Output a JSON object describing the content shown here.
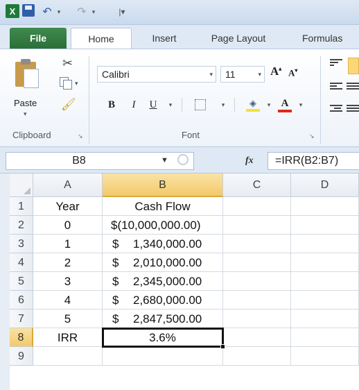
{
  "title_bar": {
    "app_icon": "excel-logo",
    "app_letter": "X",
    "quick_access": [
      "save-icon",
      "undo-icon",
      "redo-icon",
      "customize-icon"
    ]
  },
  "tabs": {
    "file": "File",
    "home": "Home",
    "insert": "Insert",
    "page_layout": "Page Layout",
    "formulas": "Formulas"
  },
  "ribbon": {
    "clipboard": {
      "paste_label": "Paste",
      "group_label": "Clipboard"
    },
    "font": {
      "font_name": "Calibri",
      "font_size": "11",
      "bold": "B",
      "italic": "I",
      "underline": "U",
      "grow_font": "A",
      "shrink_font": "A",
      "font_color_glyph": "A",
      "group_label": "Font",
      "fill_color": "#f2e23a",
      "font_color": "#e0261b"
    }
  },
  "formula_bar": {
    "name_box": "B8",
    "fx_label": "fx",
    "formula": "=IRR(B2:B7)"
  },
  "sheet": {
    "columns": [
      "A",
      "B",
      "C",
      "D"
    ],
    "selected_column": "B",
    "rows": [
      "1",
      "2",
      "3",
      "4",
      "5",
      "6",
      "7",
      "8",
      "9"
    ],
    "selected_row": "8",
    "header_row": {
      "a": "Year",
      "b": "Cash Flow"
    },
    "data": [
      {
        "year": "0",
        "currency": "$",
        "amount": "(10,000,000.00)"
      },
      {
        "year": "1",
        "currency": "$",
        "amount": "1,340,000.00"
      },
      {
        "year": "2",
        "currency": "$",
        "amount": "2,010,000.00"
      },
      {
        "year": "3",
        "currency": "$",
        "amount": "2,345,000.00"
      },
      {
        "year": "4",
        "currency": "$",
        "amount": "2,680,000.00"
      },
      {
        "year": "5",
        "currency": "$",
        "amount": "2,847,500.00"
      }
    ],
    "irr_label": "IRR",
    "irr_value": "3.6%",
    "active_cell": "B8"
  }
}
